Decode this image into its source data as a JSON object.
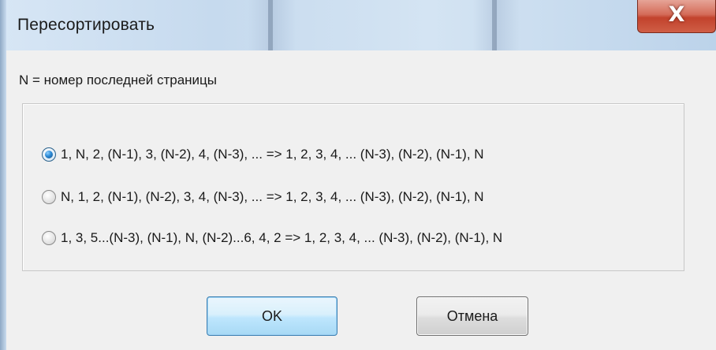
{
  "window": {
    "title": "Пересортировать",
    "close_icon": "close-icon",
    "close_glyph": "X"
  },
  "dialog": {
    "info_label": "N = номер последней страницы",
    "options": [
      {
        "label": "1, N, 2, (N-1), 3, (N-2), 4, (N-3), ... => 1, 2, 3, 4,  ... (N-3), (N-2), (N-1), N",
        "checked": true
      },
      {
        "label": "N, 1, 2, (N-1), (N-2), 3, 4, (N-3), ... => 1, 2, 3, 4,  ... (N-3), (N-2), (N-1), N",
        "checked": false
      },
      {
        "label": "1, 3, 5...(N-3), (N-1), N, (N-2)...6, 4, 2 => 1, 2, 3, 4,  ... (N-3), (N-2), (N-1), N",
        "checked": false
      }
    ],
    "ok_label": "OK",
    "cancel_label": "Отмена"
  },
  "colors": {
    "close_button": "#c7452f",
    "ok_border": "#3c7fb1",
    "client_bg": "#f0f0f0"
  }
}
